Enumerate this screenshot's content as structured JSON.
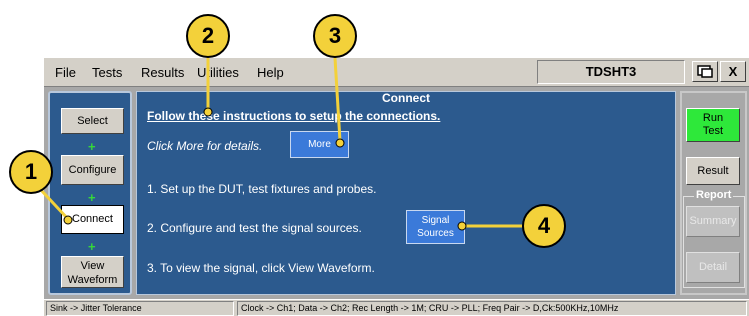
{
  "menu": {
    "items": [
      "File",
      "Tests",
      "Results",
      "Utilities",
      "Help"
    ],
    "app_title": "TDSHT3",
    "close_label": "X",
    "minimize_icon": "minimize-window-icon"
  },
  "left_nav": {
    "select": "Select",
    "configure": "Configure",
    "connect": "Connect",
    "view_line1": "View",
    "view_line2": "Waveform",
    "arrow_glyph": "+"
  },
  "panel": {
    "title": "Connect",
    "heading": "Follow these instructions to setup the connections.",
    "hint": "Click More for details.",
    "more_button": "More",
    "step1": "1. Set up the DUT, test fixtures and probes.",
    "step2": "2. Configure and test the signal sources.",
    "step3": "3. To view the signal, click View Waveform.",
    "signal_sources_line1": "Signal",
    "signal_sources_line2": "Sources"
  },
  "right_panel": {
    "run_line1": "Run",
    "run_line2": "Test",
    "result": "Result",
    "report_group": "Report",
    "summary": "Summary",
    "detail": "Detail"
  },
  "status": {
    "left": "Sink -> Jitter Tolerance",
    "right": "Clock -> Ch1; Data -> Ch2; Rec Length -> 1M; CRU -> PLL; Freq Pair -> D,Ck:500KHz,10MHz"
  },
  "callouts": [
    "1",
    "2",
    "3",
    "4"
  ],
  "colors": {
    "panel_blue": "#2c5a8e",
    "button_blue": "#3b7ad9",
    "run_green": "#2ee83a",
    "callout_yellow": "#f3d13a"
  }
}
